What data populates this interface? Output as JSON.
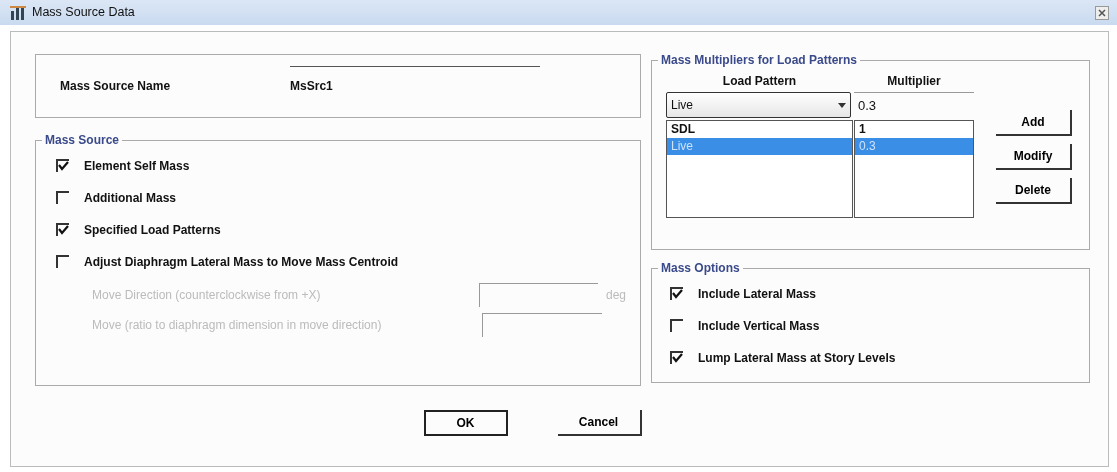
{
  "window": {
    "title": "Mass Source Data"
  },
  "mass_source_name": {
    "label": "Mass Source Name",
    "value": "MsSrc1"
  },
  "mass_source": {
    "title": "Mass Source",
    "options": [
      {
        "label": "Element Self Mass",
        "checked": true
      },
      {
        "label": "Additional Mass",
        "checked": false
      },
      {
        "label": "Specified Load Patterns",
        "checked": true
      },
      {
        "label": "Adjust Diaphragm Lateral Mass to Move Mass Centroid",
        "checked": false
      }
    ],
    "fields": [
      {
        "label": "Move Direction (counterclockwise from +X)",
        "unit": "deg",
        "disabled": true
      },
      {
        "label": "Move (ratio to diaphragm dimension in move direction)",
        "disabled": true
      }
    ]
  },
  "mass_multipliers": {
    "title": "Mass Multipliers for Load Patterns",
    "columns": [
      "Load Pattern",
      "Multiplier"
    ],
    "load_pattern_select": "Live",
    "multiplier_value": "0.3",
    "rows": [
      {
        "load_pattern": "SDL",
        "multiplier": "1",
        "selected": false
      },
      {
        "load_pattern": "Live",
        "multiplier": "0.3",
        "selected": true
      }
    ],
    "buttons": [
      "Add",
      "Modify",
      "Delete"
    ]
  },
  "mass_options": {
    "title": "Mass Options",
    "options": [
      {
        "label": "Include Lateral Mass",
        "checked": true
      },
      {
        "label": "Include Vertical Mass",
        "checked": false
      },
      {
        "label": "Lump Lateral Mass at Story Levels",
        "checked": true
      }
    ]
  },
  "buttons": [
    {
      "label": "OK",
      "default": true
    },
    {
      "label": "Cancel",
      "default": false
    }
  ]
}
